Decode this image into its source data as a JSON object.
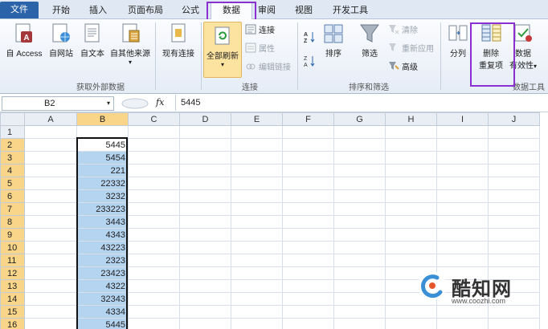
{
  "tabs": [
    "文件",
    "开始",
    "插入",
    "页面布局",
    "公式",
    "数据",
    "审阅",
    "视图",
    "开发工具"
  ],
  "active_tab": "数据",
  "ribbon": {
    "get_external": {
      "buttons": [
        "自 Access",
        "自网站",
        "自文本",
        "自其他来源",
        "现有连接"
      ],
      "dropdown_glyph": "▾",
      "label": "获取外部数据"
    },
    "connections": {
      "refresh_all": "全部刷新",
      "dropdown_glyph": "▾",
      "connections": "连接",
      "properties": "属性",
      "edit_links": "编辑链接",
      "label": "连接"
    },
    "sort_filter": {
      "sort": "排序",
      "filter": "筛选",
      "clear": "清除",
      "reapply": "重新应用",
      "advanced": "高级",
      "label": "排序和筛选"
    },
    "data_tools": {
      "text_to_columns": "分列",
      "remove_duplicates_line1": "删除",
      "remove_duplicates_line2": "重复项",
      "validation_line1": "数据",
      "validation_line2": "有效性",
      "dropdown_glyph": "▾",
      "label": "数据工具"
    }
  },
  "formula_bar": {
    "name_box": "B2",
    "name_box_glyph": "▾",
    "fx": "fx",
    "value": "5445"
  },
  "grid": {
    "columns": [
      "A",
      "B",
      "C",
      "D",
      "E",
      "F",
      "G",
      "H",
      "I",
      "J"
    ],
    "row_numbers": [
      "1",
      "2",
      "3",
      "4",
      "5",
      "6",
      "7",
      "8",
      "9",
      "10",
      "11",
      "12",
      "13",
      "14",
      "15",
      "16"
    ],
    "b_values": [
      "",
      "5445",
      "5454",
      "221",
      "22332",
      "3232",
      "233223",
      "3443",
      "4343",
      "43223",
      "2323",
      "23423",
      "4322",
      "32343",
      "4334",
      "5445"
    ]
  },
  "watermark": {
    "name": "酷知网",
    "url": "www.coozhi.com"
  },
  "colors": {
    "file_tab": "#2b63a9",
    "highlight_box": "#8a2fd2",
    "selection": "#b5d4f0",
    "selected_header": "#f9d58a"
  }
}
